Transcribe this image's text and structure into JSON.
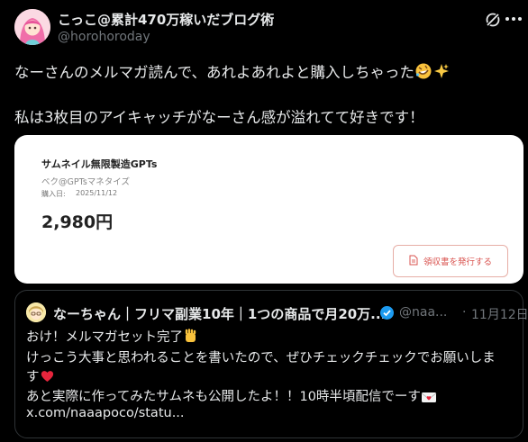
{
  "author": {
    "display_name": "こっこ@累計470万稼いだブログ術",
    "handle": "@horohoroday"
  },
  "tweet": {
    "line1": "なーさんのメルマガ読んで、あれよあれよと購入しちゃった",
    "line2": "私は3枚目のアイキャッチがなーさん感が溢れてて好きです！"
  },
  "receipt_card": {
    "product_title": "サムネイル無限製造GPTs",
    "seller": "ベク@GPTsマネタイズ",
    "purchase_date_label": "購入日:",
    "purchase_date": "2025/11/12",
    "price": "2,980円",
    "receipt_button_label": "領収書を発行する"
  },
  "quoted_tweet": {
    "display_name": "なーちゃん｜フリマ副業10年｜1つの商品で月20万...",
    "handle": "@naa...",
    "date": "11月12日",
    "line1": "おけ！メルマガセット完了",
    "line2": "けっこう大事と思われることを書いたので、ぜひチェックチェックでお願いしま",
    "line3": "す",
    "line4": "あと実際に作ってみたサムネも公開したよ！！10時半頃配信でーす",
    "link": "x.com/naaapoco/statu..."
  },
  "icons": {
    "grok": "grok-icon",
    "more": "more-icon",
    "verified": "verified-badge-icon",
    "document": "document-icon"
  },
  "colors": {
    "background": "#000000",
    "text": "#e7e9ea",
    "muted": "#71767b",
    "verified": "#1d9bf0",
    "receipt_accent": "#d9534f"
  }
}
